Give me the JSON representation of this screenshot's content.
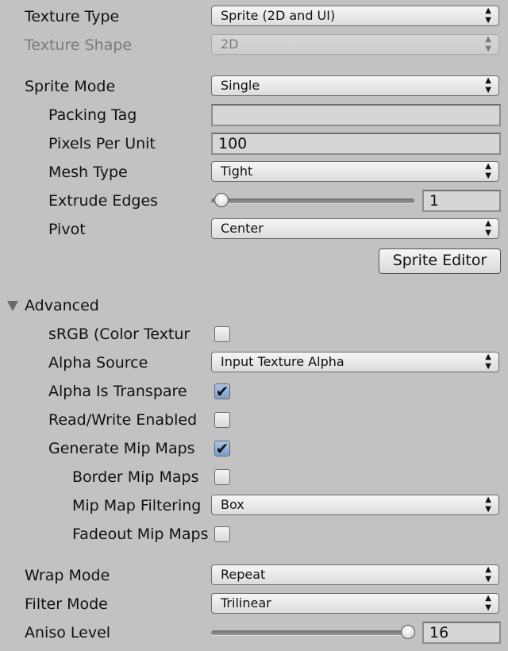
{
  "texture_type": {
    "label": "Texture Type",
    "value": "Sprite (2D and UI)"
  },
  "texture_shape": {
    "label": "Texture Shape",
    "value": "2D",
    "disabled": true
  },
  "sprite_mode": {
    "label": "Sprite Mode",
    "value": "Single"
  },
  "packing_tag": {
    "label": "Packing Tag",
    "value": ""
  },
  "pixels_per_unit": {
    "label": "Pixels Per Unit",
    "value": "100"
  },
  "mesh_type": {
    "label": "Mesh Type",
    "value": "Tight"
  },
  "extrude_edges": {
    "label": "Extrude Edges",
    "value": "1",
    "slider_fraction": 0.03
  },
  "pivot": {
    "label": "Pivot",
    "value": "Center"
  },
  "sprite_editor_button": "Sprite Editor",
  "advanced": {
    "label": "Advanced",
    "expanded": true,
    "srgb": {
      "label": "sRGB (Color Textur",
      "checked": false
    },
    "alpha_source": {
      "label": "Alpha Source",
      "value": "Input Texture Alpha"
    },
    "alpha_is_transparency": {
      "label": "Alpha Is Transpare",
      "checked": true
    },
    "read_write": {
      "label": "Read/Write Enabled",
      "checked": false
    },
    "generate_mip_maps": {
      "label": "Generate Mip Maps",
      "checked": true
    },
    "border_mip_maps": {
      "label": "Border Mip Maps",
      "checked": false
    },
    "mip_map_filtering": {
      "label": "Mip Map Filtering",
      "value": "Box"
    },
    "fadeout_mip_maps": {
      "label": "Fadeout Mip Maps",
      "checked": false
    }
  },
  "wrap_mode": {
    "label": "Wrap Mode",
    "value": "Repeat"
  },
  "filter_mode": {
    "label": "Filter Mode",
    "value": "Trilinear"
  },
  "aniso_level": {
    "label": "Aniso Level",
    "value": "16",
    "slider_fraction": 1.0
  },
  "icons": {
    "dropdown": "up-down-arrows-icon",
    "check": "checkmark-icon",
    "foldout": "triangle-down-icon"
  }
}
